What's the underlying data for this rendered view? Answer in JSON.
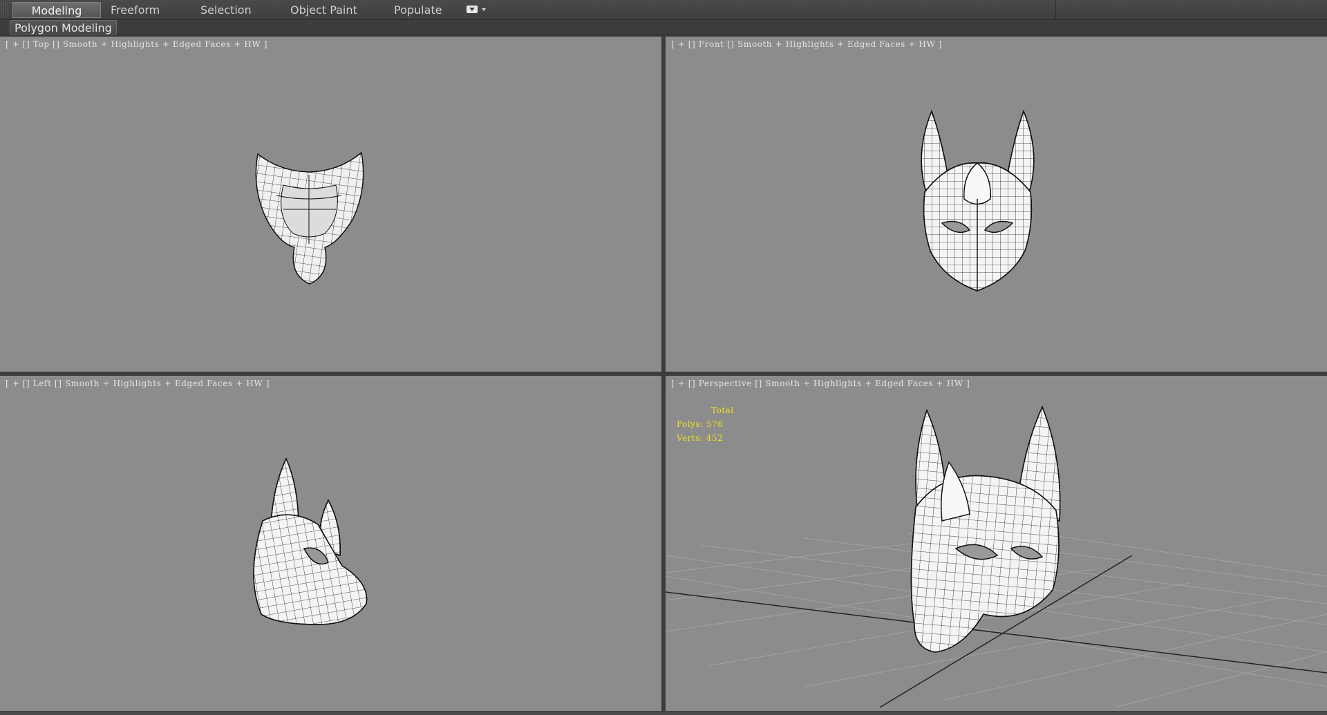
{
  "ribbon": {
    "tabs": [
      {
        "label": "Modeling",
        "active": true
      },
      {
        "label": "Freeform",
        "active": false
      },
      {
        "label": "Selection",
        "active": false
      },
      {
        "label": "Object Paint",
        "active": false
      },
      {
        "label": "Populate",
        "active": false
      }
    ],
    "options_icon": "ribbon-options-icon",
    "panel_label": "Polygon Modeling"
  },
  "viewports": {
    "top": {
      "plus": "+",
      "name": "Top",
      "shading": "Smooth + Highlights + Edged Faces + HW"
    },
    "front": {
      "plus": "+",
      "name": "Front",
      "shading": "Smooth + Highlights + Edged Faces + HW"
    },
    "left": {
      "plus": "+",
      "name": "Left",
      "shading": "Smooth + Highlights + Edged Faces + HW"
    },
    "perspective": {
      "plus": "+",
      "name": "Perspective",
      "shading": "Smooth + Highlights + Edged Faces + HW",
      "stats": {
        "total_label": "Total",
        "polys_label": "Polys:",
        "polys_value": "576",
        "verts_label": "Verts:",
        "verts_value": "452"
      }
    }
  },
  "colors": {
    "viewport_bg": "#8c8c8c",
    "stats_text": "#f2e020",
    "mesh_fill": "#f4f4f4",
    "wire": "#1a1a1a"
  }
}
